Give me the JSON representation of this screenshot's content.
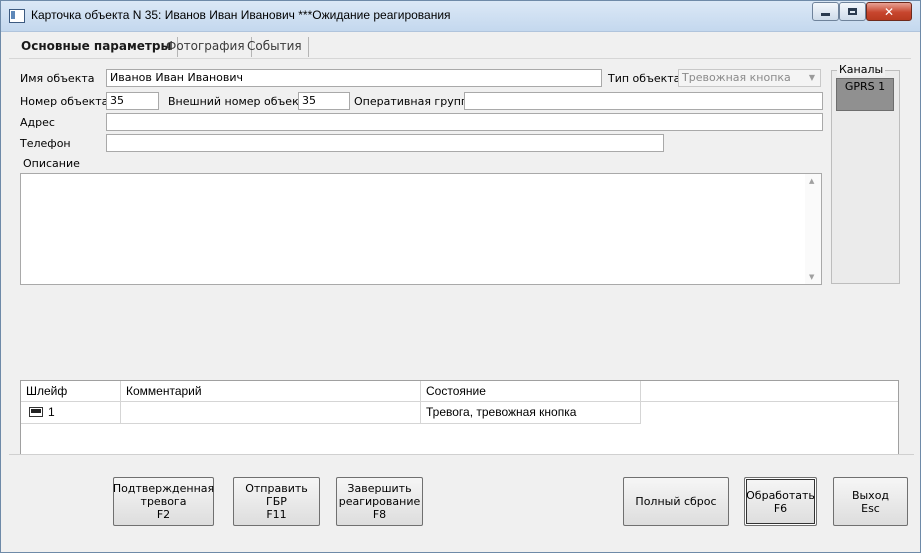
{
  "window": {
    "title": "Карточка объекта N 35: Иванов Иван Иванович ***Ожидание реагирования"
  },
  "tabs": [
    {
      "label": "Основные параметры",
      "active": true
    },
    {
      "label": "Фотография",
      "active": false
    },
    {
      "label": "События",
      "active": false
    }
  ],
  "form": {
    "object_name_label": "Имя объекта",
    "object_name_value": "Иванов Иван Иванович",
    "object_type_label": "Тип объекта",
    "object_type_value": "Тревожная кнопка",
    "object_number_label": "Номер объекта",
    "object_number_value": "35",
    "external_number_label": "Внешний номер объекта",
    "external_number_value": "35",
    "operative_group_label": "Оперативная группа",
    "operative_group_value": "",
    "address_label": "Адрес",
    "address_value": "",
    "phone_label": "Телефон",
    "phone_value": "",
    "description_label": "Описание",
    "description_value": ""
  },
  "channels": {
    "label": "Каналы",
    "items": [
      "GPRS 1"
    ]
  },
  "zones_table": {
    "columns": [
      "Шлейф",
      "Комментарий",
      "Состояние"
    ],
    "rows": [
      {
        "zone": "1",
        "comment": "",
        "state": "Тревога, тревожная кнопка"
      }
    ]
  },
  "buttons": {
    "confirmed_alarm": "Подтвержденная\nтревога\nF2",
    "send_gbr": "Отправить ГБР\nF11",
    "finish_response": "Завершить\nреагирование\nF8",
    "full_reset": "Полный сброс",
    "process": "Обработать\nF6",
    "exit": "Выход\nEsc"
  },
  "colors": {
    "window_bg": "#f0f0f0",
    "titlebar": "#c4d8ee",
    "close_button": "#c7462e",
    "channel_item": "#909090"
  }
}
